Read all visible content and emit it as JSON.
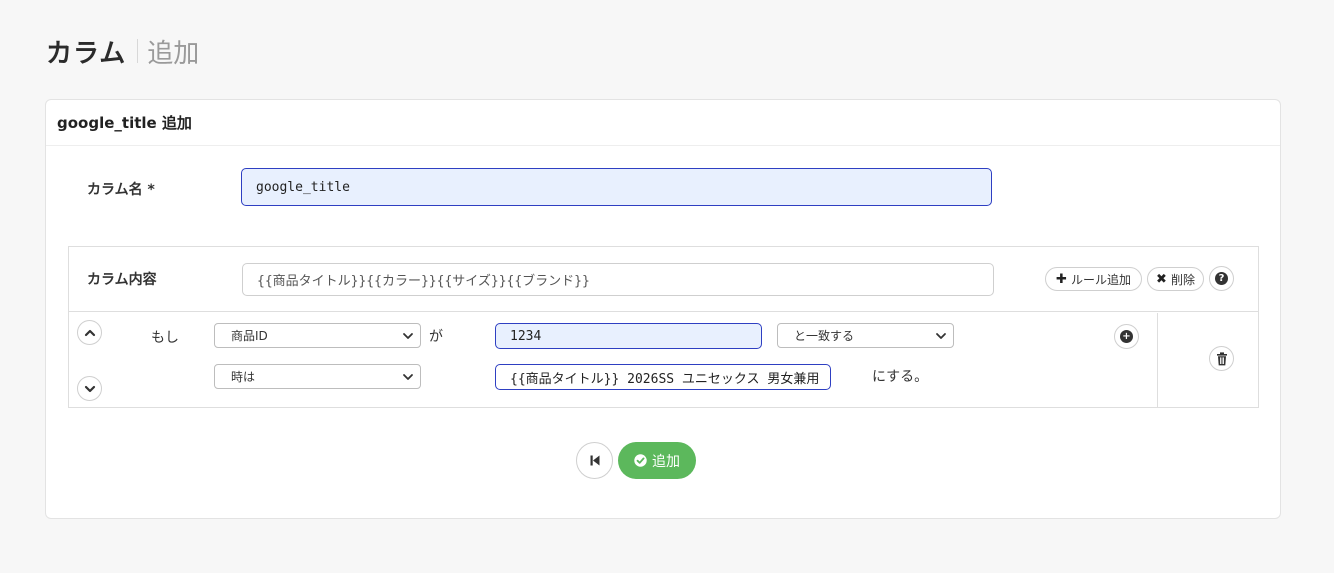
{
  "page": {
    "title": "カラム",
    "subtitle": "追加"
  },
  "card": {
    "header": "google_title 追加"
  },
  "form": {
    "column_name_label": "カラム名 *",
    "column_name_value": "google_title",
    "column_content_label": "カラム内容",
    "column_content_value": "{{商品タイトル}}{{カラー}}{{サイズ}}{{ブランド}}"
  },
  "actions": {
    "add_rule_label": "ルール追加",
    "delete_label": "削除"
  },
  "rule": {
    "if_label": "もし",
    "field_select": "商品ID",
    "ga_label": "が",
    "match_value": "1234",
    "operator_select": "と一致する",
    "when_select": "時は",
    "result_value": "{{商品タイトル}} 2026SS ユニセックス 男女兼用",
    "suffix_label": "にする。"
  },
  "footer": {
    "add_button_label": "追加"
  }
}
